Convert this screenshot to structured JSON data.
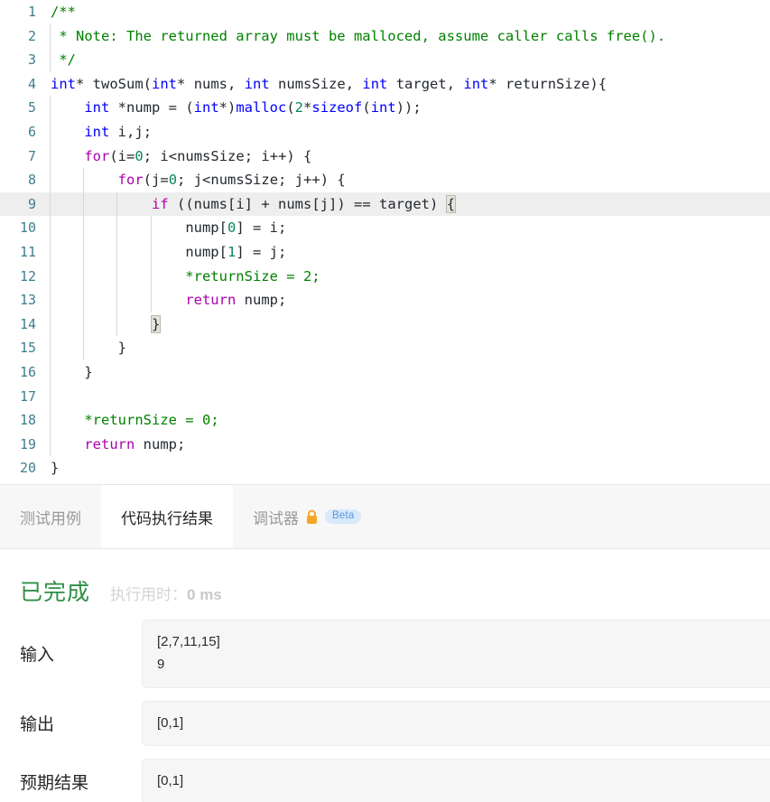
{
  "editor": {
    "language": "c",
    "active_line": 9,
    "lines": [
      {
        "n": 1,
        "indent_guides": 0,
        "text": "/**"
      },
      {
        "n": 2,
        "indent_guides": 1,
        "text": " * Note: The returned array must be malloced, assume caller calls free()."
      },
      {
        "n": 3,
        "indent_guides": 1,
        "text": " */"
      },
      {
        "n": 4,
        "indent_guides": 0,
        "text": "int* twoSum(int* nums, int numsSize, int target, int* returnSize){"
      },
      {
        "n": 5,
        "indent_guides": 1,
        "text": "    int *nump = (int*)malloc(2*sizeof(int));"
      },
      {
        "n": 6,
        "indent_guides": 1,
        "text": "    int i,j;"
      },
      {
        "n": 7,
        "indent_guides": 1,
        "text": "    for(i=0; i<numsSize; i++) {"
      },
      {
        "n": 8,
        "indent_guides": 2,
        "text": "        for(j=0; j<numsSize; j++) {"
      },
      {
        "n": 9,
        "indent_guides": 3,
        "text": "            if ((nums[i] + nums[j]) == target) {"
      },
      {
        "n": 10,
        "indent_guides": 4,
        "text": "                nump[0] = i;"
      },
      {
        "n": 11,
        "indent_guides": 4,
        "text": "                nump[1] = j;"
      },
      {
        "n": 12,
        "indent_guides": 4,
        "text": "                *returnSize = 2;"
      },
      {
        "n": 13,
        "indent_guides": 4,
        "text": "                return nump;"
      },
      {
        "n": 14,
        "indent_guides": 3,
        "text": "            }"
      },
      {
        "n": 15,
        "indent_guides": 2,
        "text": "        }"
      },
      {
        "n": 16,
        "indent_guides": 1,
        "text": "    }"
      },
      {
        "n": 17,
        "indent_guides": 1,
        "text": ""
      },
      {
        "n": 18,
        "indent_guides": 1,
        "text": "    *returnSize = 0;"
      },
      {
        "n": 19,
        "indent_guides": 1,
        "text": "    return nump;"
      },
      {
        "n": 20,
        "indent_guides": 0,
        "text": "}"
      }
    ]
  },
  "tabs": [
    {
      "id": "testcase",
      "label": "测试用例",
      "active": false,
      "lock": false,
      "badge": null
    },
    {
      "id": "result",
      "label": "代码执行结果",
      "active": true,
      "lock": false,
      "badge": null
    },
    {
      "id": "debugger",
      "label": "调试器",
      "active": false,
      "lock": true,
      "badge": "Beta"
    }
  ],
  "result": {
    "verdict": "已完成",
    "runtime_label": "执行用时：",
    "runtime_value": "0 ms",
    "rows": [
      {
        "label": "输入",
        "value": "[2,7,11,15]\n9"
      },
      {
        "label": "输出",
        "value": "[0,1]"
      },
      {
        "label": "预期结果",
        "value": "[0,1]"
      }
    ]
  },
  "colors": {
    "verdict_green": "#2f8f46",
    "lock_orange": "#f5a623",
    "badge_bg": "#d7e9fb",
    "badge_text": "#5a9ae0",
    "line_number": "#3f7f8f",
    "comment_green": "#008000",
    "keyword_blue": "#0000ff",
    "control_magenta": "#aa00aa",
    "number_teal": "#098658",
    "active_line_bg": "#eeeeee"
  }
}
